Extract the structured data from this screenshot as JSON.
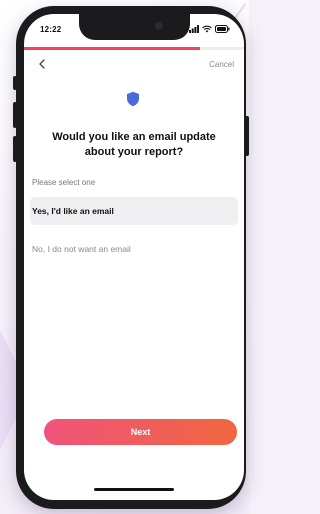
{
  "status_bar": {
    "time": "12:22",
    "icons": [
      "signal-icon",
      "wifi-icon",
      "battery-icon"
    ]
  },
  "progress": {
    "fraction": 0.8,
    "color": "#f0445a"
  },
  "nav": {
    "back_icon": "chevron-left-icon",
    "cancel_label": "Cancel"
  },
  "header_icon": {
    "name": "shield-icon",
    "color": "#4a6bd8"
  },
  "question": {
    "text": "Would you like an email update about your report?"
  },
  "helper_text": "Please select one",
  "options": [
    {
      "label": "Yes, I'd like an email",
      "selected": true
    },
    {
      "label": "No, I do not want an email",
      "selected": false
    }
  ],
  "next_button": {
    "label": "Next",
    "gradient_start": "#f0537a",
    "gradient_end": "#f0663e"
  }
}
